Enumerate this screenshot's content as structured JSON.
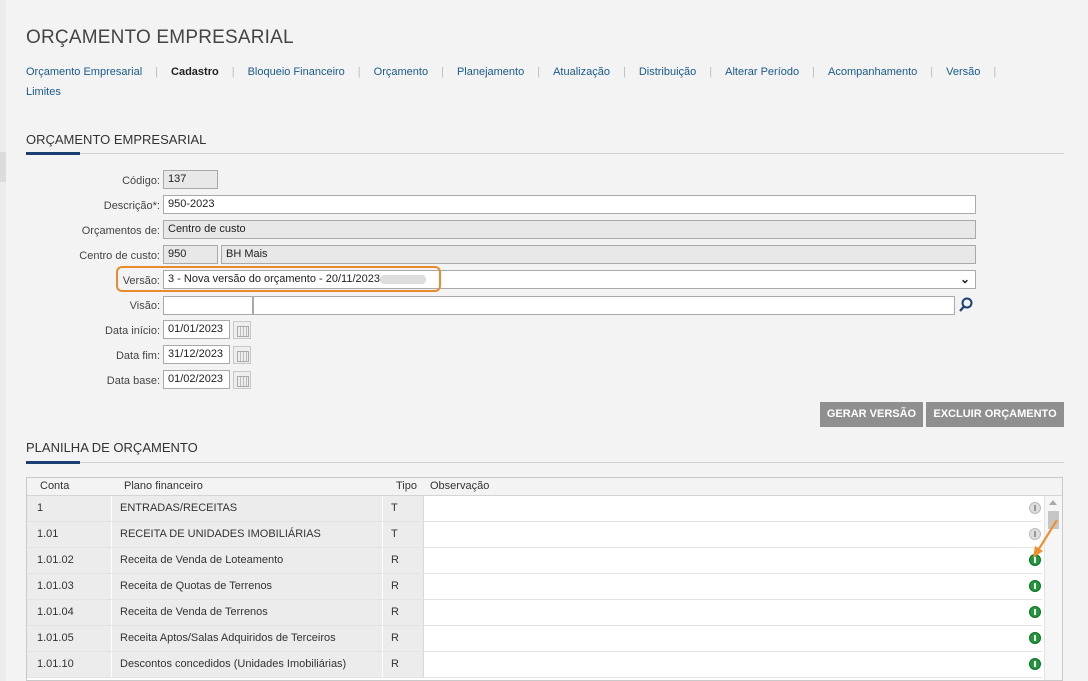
{
  "app": {
    "title": "ORÇAMENTO EMPRESARIAL"
  },
  "nav": {
    "items": [
      {
        "label": "Orçamento Empresarial",
        "active": false
      },
      {
        "label": "Cadastro",
        "active": true
      },
      {
        "label": "Bloqueio Financeiro",
        "active": false
      },
      {
        "label": "Orçamento",
        "active": false
      },
      {
        "label": "Planejamento",
        "active": false
      },
      {
        "label": "Atualização",
        "active": false
      },
      {
        "label": "Distribuição",
        "active": false
      },
      {
        "label": "Alterar Período",
        "active": false
      },
      {
        "label": "Acompanhamento",
        "active": false
      },
      {
        "label": "Versão",
        "active": false
      },
      {
        "label": "Limites",
        "active": false
      }
    ]
  },
  "form": {
    "section_title": "ORÇAMENTO EMPRESARIAL",
    "codigo": {
      "label": "Código:",
      "value": "137"
    },
    "descricao": {
      "label": "Descrição*:",
      "value": "950-2023"
    },
    "orcamentos_de": {
      "label": "Orçamentos de:",
      "value": "Centro de custo"
    },
    "centro_custo": {
      "label": "Centro de custo:",
      "code": "950",
      "name": "BH Mais"
    },
    "versao": {
      "label": "Versão:",
      "value": "3 - Nova versão do orçamento - 20/11/2023"
    },
    "visao": {
      "label": "Visão:",
      "code": "",
      "name": ""
    },
    "data_inicio": {
      "label": "Data início:",
      "value": "01/01/2023"
    },
    "data_fim": {
      "label": "Data fim:",
      "value": "31/12/2023"
    },
    "data_base": {
      "label": "Data base:",
      "value": "01/02/2023"
    }
  },
  "actions": {
    "gerar_versao": "GERAR VERSÃO",
    "excluir_orcamento": "EXCLUIR ORÇAMENTO"
  },
  "planilha": {
    "section_title": "PLANILHA DE ORÇAMENTO",
    "columns": {
      "conta": "Conta",
      "plano": "Plano financeiro",
      "tipo": "Tipo",
      "obs": "Observação"
    },
    "rows": [
      {
        "conta": "1",
        "plano": "ENTRADAS/RECEITAS",
        "tipo": "T",
        "active": false
      },
      {
        "conta": "1.01",
        "plano": "RECEITA DE UNIDADES IMOBILIÁRIAS",
        "tipo": "T",
        "active": false
      },
      {
        "conta": "1.01.02",
        "plano": "Receita de Venda de Loteamento",
        "tipo": "R",
        "active": true
      },
      {
        "conta": "1.01.03",
        "plano": "Receita de Quotas de Terrenos",
        "tipo": "R",
        "active": true
      },
      {
        "conta": "1.01.04",
        "plano": "Receita de Venda de Terrenos",
        "tipo": "R",
        "active": true
      },
      {
        "conta": "1.01.05",
        "plano": "Receita Aptos/Salas Adquiridos de Terceiros",
        "tipo": "R",
        "active": true
      },
      {
        "conta": "1.01.10",
        "plano": "Descontos concedidos (Unidades Imobiliárias)",
        "tipo": "R",
        "active": true
      }
    ]
  },
  "colors": {
    "accent": "#1c3f73",
    "highlight": "#e88a2e",
    "button": "#8f8f8f",
    "money_active": "#1e9a3a"
  },
  "icons": {
    "search": "search-icon",
    "calendar": "calendar-icon",
    "money": "money-icon",
    "chevron": "chevron-down-icon"
  }
}
